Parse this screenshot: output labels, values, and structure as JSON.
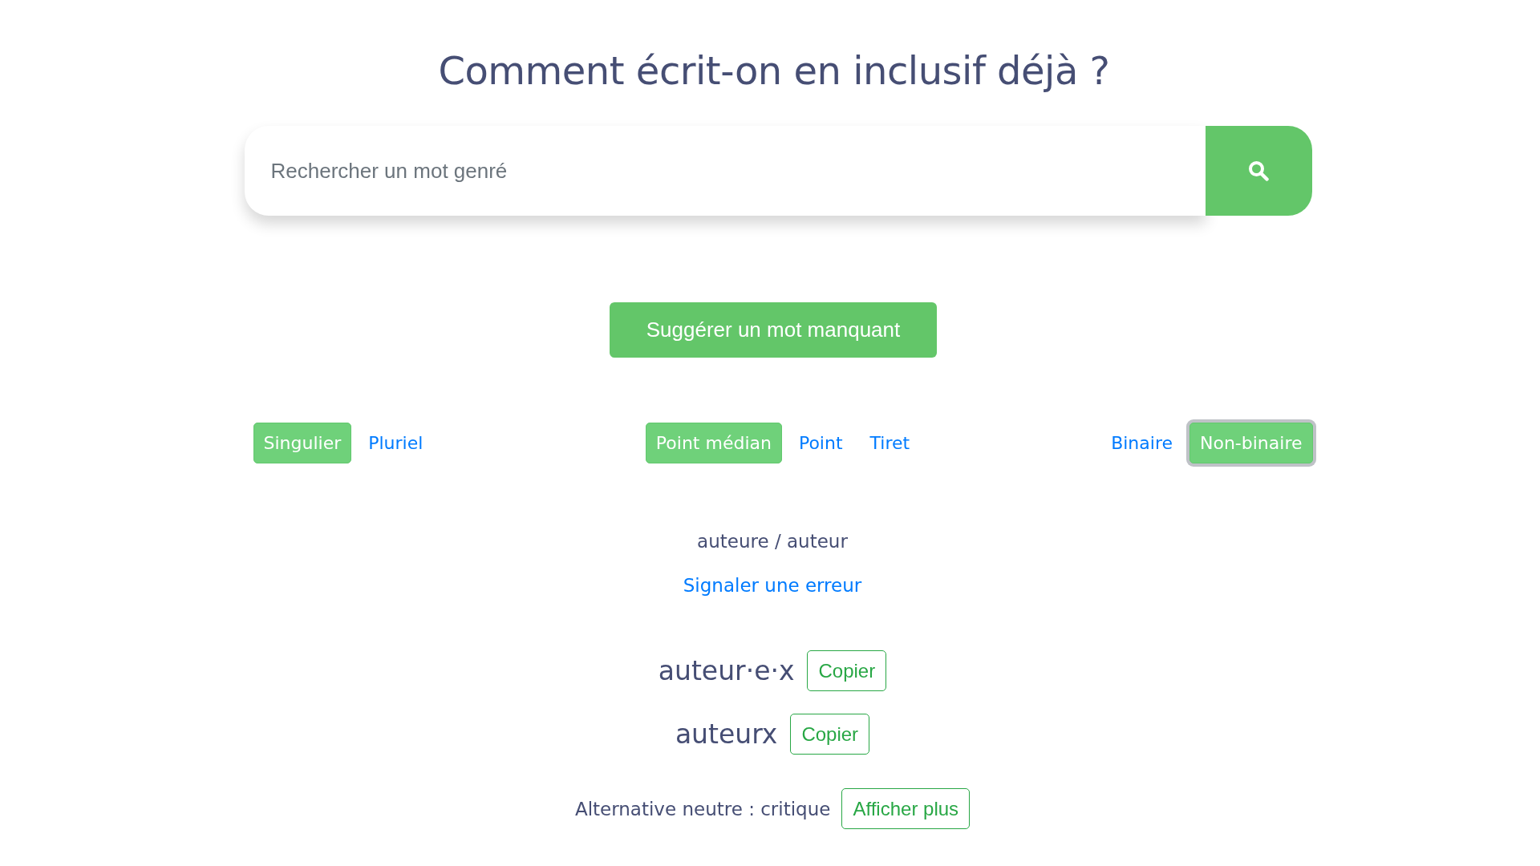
{
  "title": "Comment écrit-on en inclusif déjà ?",
  "search": {
    "placeholder": "Rechercher un mot genré"
  },
  "suggest_button": "Suggérer un mot manquant",
  "option_groups": [
    {
      "options": [
        {
          "label": "Singulier",
          "selected": true,
          "focused": false
        },
        {
          "label": "Pluriel",
          "selected": false,
          "focused": false
        }
      ]
    },
    {
      "options": [
        {
          "label": "Point médian",
          "selected": true,
          "focused": false
        },
        {
          "label": "Point",
          "selected": false,
          "focused": false
        },
        {
          "label": "Tiret",
          "selected": false,
          "focused": false
        }
      ]
    },
    {
      "options": [
        {
          "label": "Binaire",
          "selected": false,
          "focused": false
        },
        {
          "label": "Non-binaire",
          "selected": true,
          "focused": true
        }
      ]
    }
  ],
  "result": {
    "word_pair": "auteure / auteur",
    "report_link": "Signaler une erreur",
    "forms": [
      {
        "text": "auteur·e·x",
        "copy_button": "Copier"
      },
      {
        "text": "auteurx",
        "copy_button": "Copier"
      }
    ],
    "alternative": {
      "text": "Alternative neutre : critique",
      "button": "Afficher plus"
    }
  }
}
